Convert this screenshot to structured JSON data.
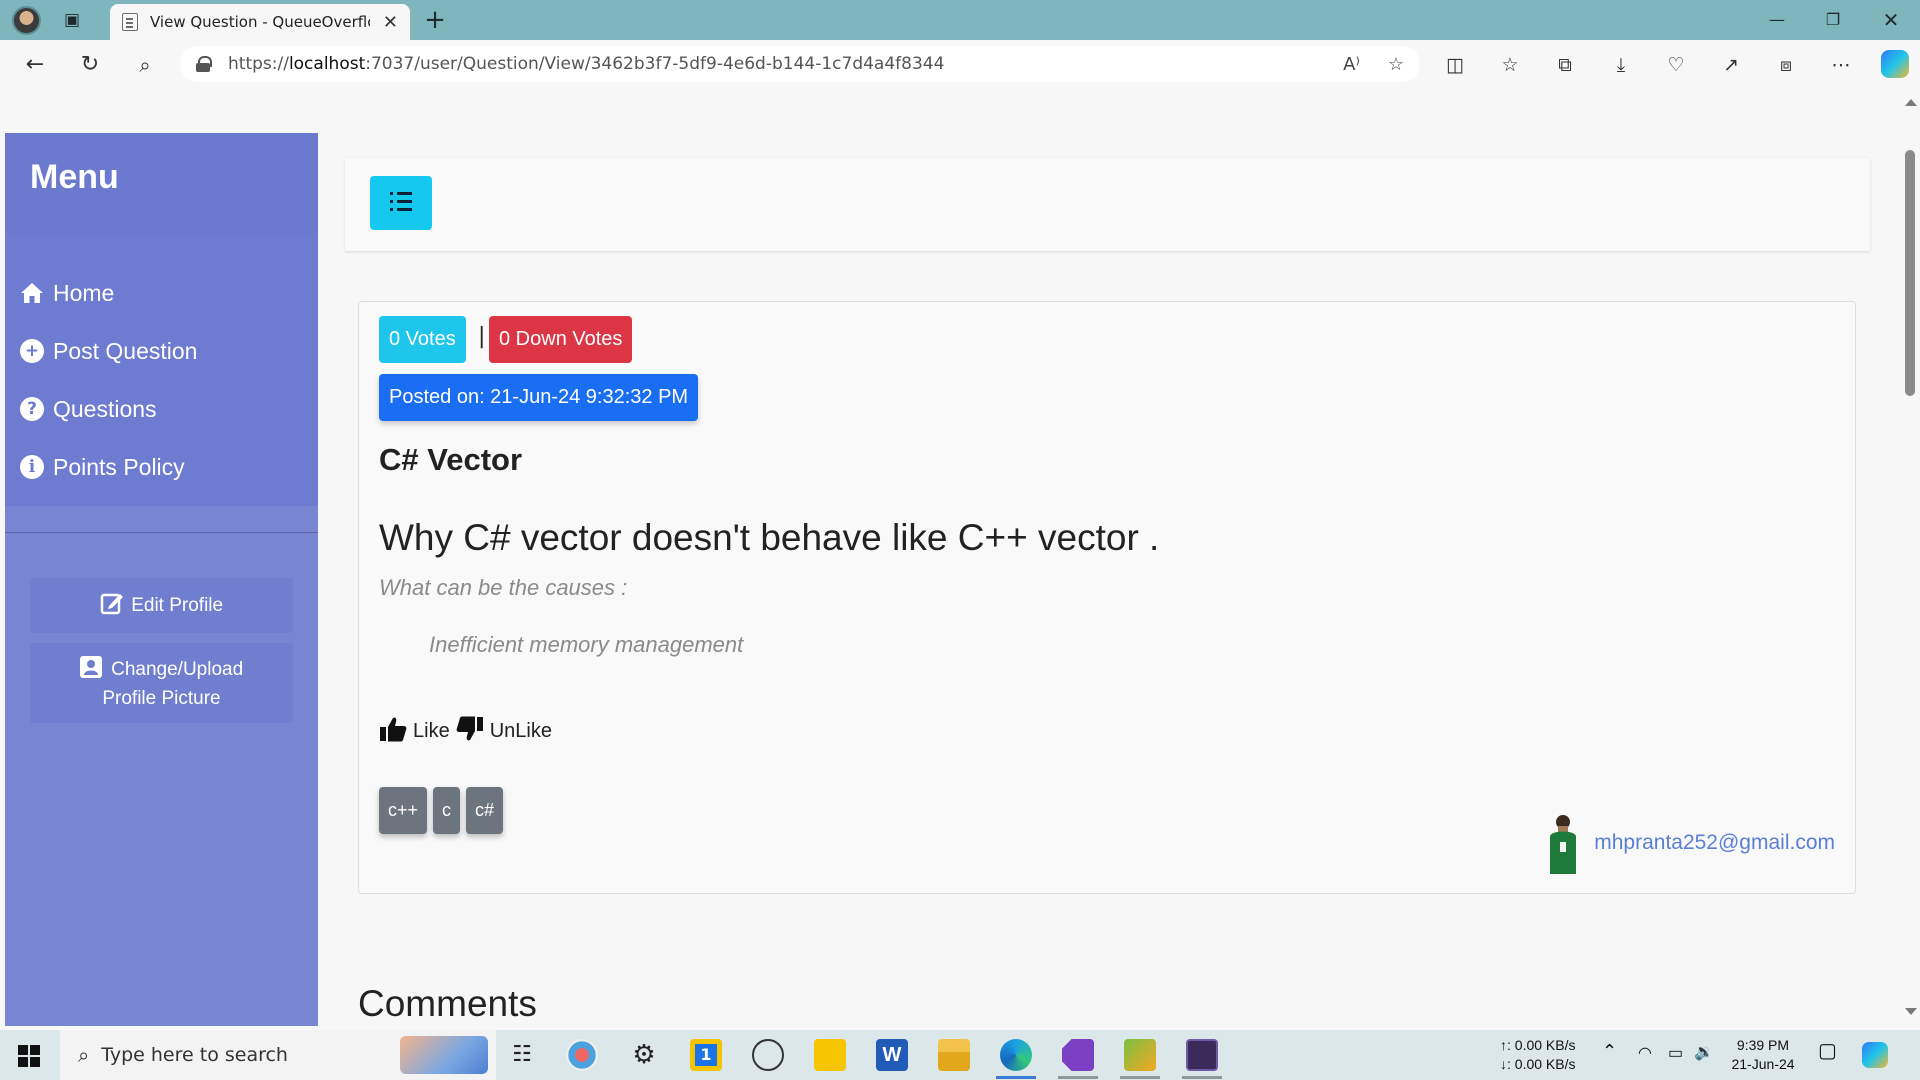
{
  "browser": {
    "tab_title": "View Question - QueueOverflow.",
    "url_prefix": "https://",
    "url_host": "localhost",
    "url_rest": ":7037/user/Question/View/3462b3f7-5df9-4e6d-b144-1c7d4a4f8344",
    "read_aloud": "A⁾"
  },
  "sidebar": {
    "title": "Menu",
    "items": [
      {
        "label": "Home",
        "icon": "home-icon"
      },
      {
        "label": "Post Question",
        "icon": "plus-circle-icon"
      },
      {
        "label": "Questions",
        "icon": "question-circle-icon"
      },
      {
        "label": "Points Policy",
        "icon": "info-circle-icon"
      }
    ],
    "edit_profile": "Edit Profile",
    "upload_line1": "Change/Upload",
    "upload_line2": "Profile Picture"
  },
  "question": {
    "votes": "0 Votes",
    "separator": "|",
    "down_votes": "0 Down Votes",
    "posted": "Posted on: 21-Jun-24 9:32:32 PM",
    "title": "C# Vector",
    "body_heading": "Why C# vector doesn't behave like C++ vector .",
    "body_line1": "What can be the causes :",
    "body_line2": "Inefficient memory management",
    "like": "Like",
    "unlike": "UnLike",
    "tags": [
      "c++",
      "c",
      "c#"
    ],
    "author_email": "mhpranta252@gmail.com"
  },
  "comments_heading": "Comments",
  "taskbar": {
    "search_placeholder": "Type here to search",
    "net_up": "↑: 0.00 KB/s",
    "net_down": "↓: 0.00 KB/s",
    "time": "9:39 PM",
    "date": "21-Jun-24"
  },
  "colors": {
    "sidebar": "#7885d2",
    "votes": "#1ec6ec",
    "down_votes": "#dc3545",
    "posted": "#1a6ef3",
    "tag": "#6c757d"
  }
}
